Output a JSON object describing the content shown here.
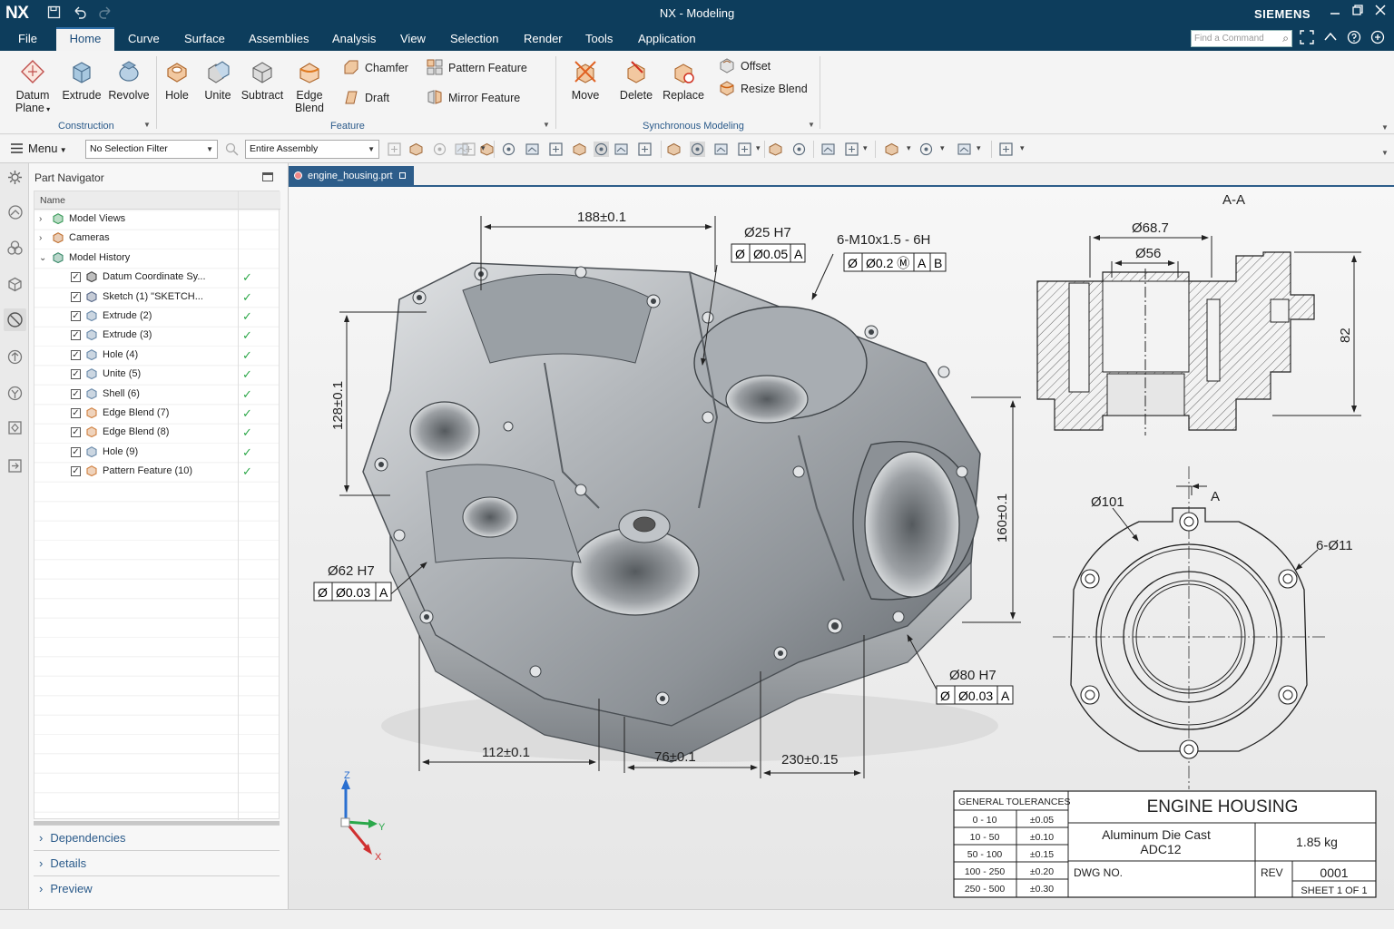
{
  "app": {
    "logo": "NX",
    "title": "NX - Modeling",
    "brand": "SIEMENS",
    "qa_icons": [
      "save-icon",
      "undo-icon",
      "redo-icon"
    ],
    "window_controls": [
      "minimize-icon",
      "restore-icon",
      "close-icon"
    ]
  },
  "menu": {
    "tabs": [
      "File",
      "Home",
      "Curve",
      "Surface",
      "Assemblies",
      "Analysis",
      "View",
      "Selection",
      "Render",
      "Tools",
      "Application"
    ],
    "active_tab": "Home",
    "find_placeholder": "Find a Command"
  },
  "ribbon": {
    "groups": {
      "construction": "Construction",
      "feature": "Feature",
      "sync": "Synchronous Modeling"
    },
    "buttons": {
      "datum_plane_1": "Datum",
      "datum_plane_2": "Plane",
      "extrude": "Extrude",
      "revolve": "Revolve",
      "hole": "Hole",
      "unite": "Unite",
      "subtract": "Subtract",
      "edge_blend_1": "Edge",
      "edge_blend_2": "Blend",
      "chamfer": "Chamfer",
      "draft": "Draft",
      "pattern_feature": "Pattern Feature",
      "mirror_feature": "Mirror Feature",
      "move": "Move",
      "delete": "Delete",
      "replace": "Replace",
      "offset": "Offset",
      "resize_blend": "Resize Blend"
    }
  },
  "toolbar": {
    "menu_label": "Menu",
    "selection_filter": "No Selection Filter",
    "scope": "Entire Assembly"
  },
  "navigator": {
    "title": "Part Navigator",
    "column_name": "Name",
    "nodes": [
      {
        "label": "Model Views",
        "icon": "model-views-icon"
      },
      {
        "label": "Cameras",
        "icon": "cameras-icon"
      },
      {
        "label": "Model History",
        "icon": "model-history-icon"
      }
    ],
    "features": [
      {
        "label": "Datum Coordinate Sy...",
        "icon": "datum-csys-icon",
        "status": "✓"
      },
      {
        "label": "Sketch (1) \"SKETCH...",
        "icon": "sketch-icon",
        "status": "✓"
      },
      {
        "label": "Extrude (2)",
        "icon": "extrude-icon",
        "status": "✓"
      },
      {
        "label": "Extrude (3)",
        "icon": "extrude-icon",
        "status": "✓"
      },
      {
        "label": "Hole (4)",
        "icon": "hole-icon",
        "status": "✓"
      },
      {
        "label": "Unite (5)",
        "icon": "unite-icon",
        "status": "✓"
      },
      {
        "label": "Shell (6)",
        "icon": "shell-icon",
        "status": "✓"
      },
      {
        "label": "Edge Blend (7)",
        "icon": "edge-blend-icon",
        "status": "✓"
      },
      {
        "label": "Edge Blend (8)",
        "icon": "edge-blend-icon",
        "status": "✓"
      },
      {
        "label": "Hole (9)",
        "icon": "hole-icon",
        "status": "✓"
      },
      {
        "label": "Pattern Feature (10)",
        "icon": "pattern-icon",
        "status": "✓"
      }
    ],
    "sections": [
      "Dependencies",
      "Details",
      "Preview"
    ]
  },
  "file_tab": {
    "label": "engine_housing.prt"
  },
  "drawing": {
    "section_label": "A-A",
    "view_label": "A",
    "dims": {
      "d188": "188±0.1",
      "d128": "128±0.1",
      "d160": "160±0.1",
      "d112": "112±0.1",
      "d76": "76±0.1",
      "d230": "230±0.15",
      "phi25": "Ø25 H7",
      "thread": "6-M10x1.5 - 6H",
      "phi62": "Ø62 H7",
      "phi80": "Ø80 H7",
      "phi68": "Ø68.7",
      "phi56": "Ø56",
      "d82": "82",
      "phi101": "Ø101",
      "holes11": "6-Ø11"
    },
    "fcf": {
      "f1": [
        "Ø",
        "Ø0.05",
        "A"
      ],
      "f2": [
        "Ø",
        "Ø0.2 Ⓜ",
        "A",
        "B"
      ],
      "f3": [
        "Ø",
        "Ø0.03",
        "A"
      ],
      "f4": [
        "Ø",
        "Ø0.03",
        "A"
      ]
    },
    "triad": {
      "x": "X",
      "y": "Y",
      "z": "Z"
    },
    "title_block": {
      "tol_header": "GENERAL TOLERANCES",
      "tolerances": [
        {
          "range": "0 - 10",
          "tol": "±0.05"
        },
        {
          "range": "10 - 50",
          "tol": "±0.10"
        },
        {
          "range": "50 - 100",
          "tol": "±0.15"
        },
        {
          "range": "100 - 250",
          "tol": "±0.20"
        },
        {
          "range": "250 - 500",
          "tol": "±0.30"
        }
      ],
      "part_name": "ENGINE HOUSING",
      "material_1": "Aluminum Die Cast",
      "material_2": "ADC12",
      "mass": "1.85 kg",
      "dwg_label": "DWG NO.",
      "rev_label": "REV",
      "dwg_no": "0001",
      "sheet": "SHEET 1 OF 1"
    }
  }
}
